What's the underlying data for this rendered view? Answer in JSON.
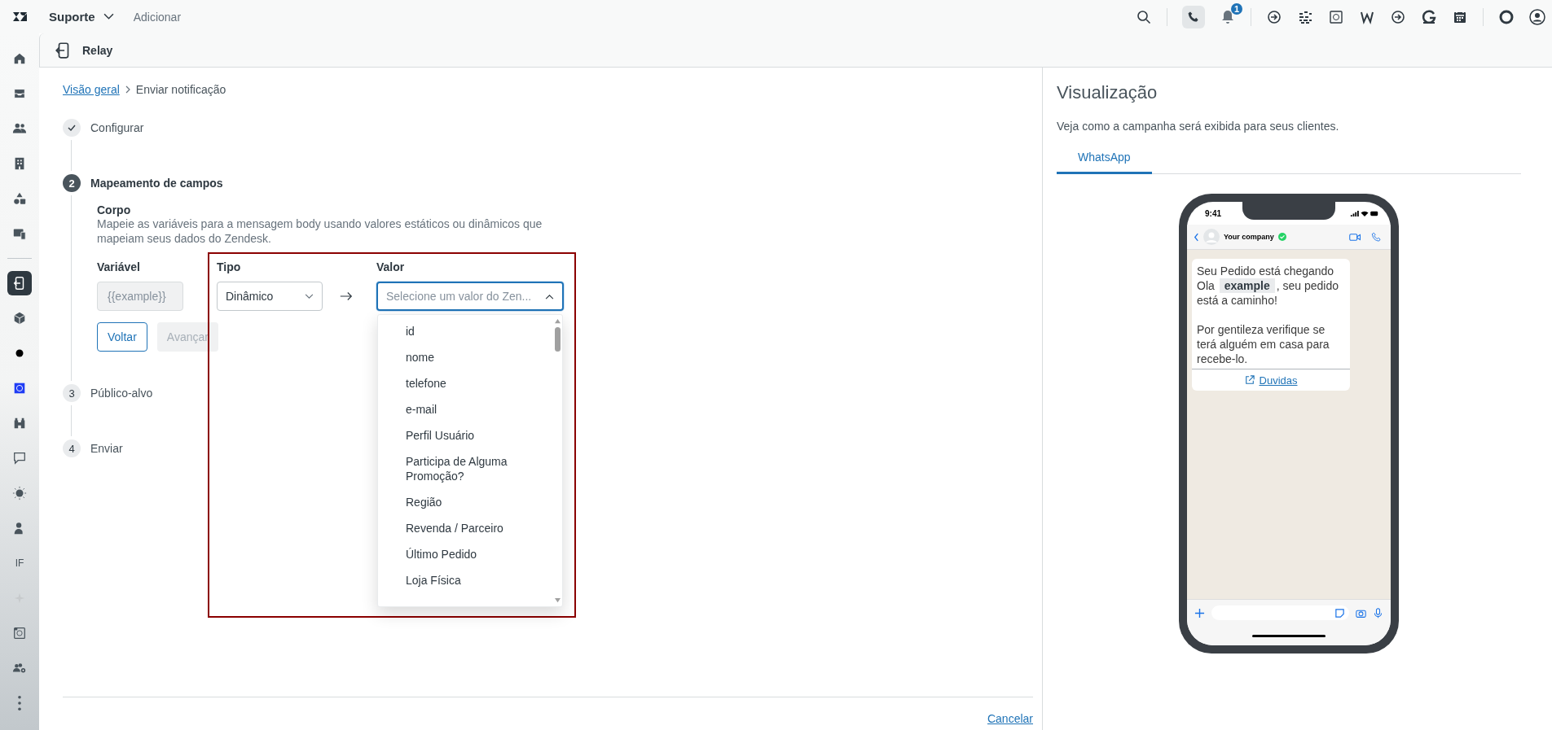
{
  "topbar": {
    "product": "Suporte",
    "add": "Adicionar",
    "notification_count": "1"
  },
  "sidebar": {
    "items": [
      {
        "selected": false
      },
      {
        "selected": false
      },
      {
        "selected": false
      },
      {
        "selected": false
      },
      {
        "selected": false
      },
      {
        "selected": false
      },
      {
        "selected": true
      },
      {
        "selected": false
      },
      {
        "selected": false
      },
      {
        "selected": false
      },
      {
        "selected": false
      },
      {
        "selected": false
      },
      {
        "selected": false
      },
      {
        "selected": false
      },
      {
        "selected": false,
        "label": "IF"
      },
      {
        "selected": false
      },
      {
        "selected": false
      },
      {
        "selected": false
      },
      {
        "selected": false
      }
    ]
  },
  "header": {
    "title": "Relay"
  },
  "breadcrumb": {
    "link": "Visão geral",
    "current": "Enviar notificação"
  },
  "steps": [
    {
      "kind": "done",
      "label": "Configurar"
    },
    {
      "kind": "current",
      "number": "2",
      "label": "Mapeamento de campos"
    },
    {
      "kind": "pending",
      "number": "3",
      "label": "Público-alvo"
    },
    {
      "kind": "pending",
      "number": "4",
      "label": "Enviar"
    }
  ],
  "mapping": {
    "section_title": "Corpo",
    "description": "Mapeie as variáveis para a mensagem body usando valores estáticos ou dinâmicos que mapeiam seus dados do Zendesk.",
    "columns": [
      "Variável",
      "Tipo",
      "Valor"
    ],
    "variable": "{{example}}",
    "type": "Dinâmico",
    "value_placeholder": "Selecione um valor do Zen...",
    "expanded": true,
    "options": [
      "id",
      "nome",
      "telefone",
      "e-mail",
      "Perfil Usuário",
      "Participa de Alguma Promoção?",
      "Região",
      "Revenda / Parceiro",
      "Último Pedido",
      "Loja Física"
    ],
    "back_button": "Voltar",
    "next_button": {
      "label": "Avançar",
      "disabled": true
    }
  },
  "footer": {
    "cancel": "Cancelar"
  },
  "preview": {
    "title": "Visualização",
    "description": "Veja como a campanha será exibida para seus clientes.",
    "tabs": [
      {
        "label": "WhatsApp",
        "selected": true
      }
    ],
    "phone": {
      "time": "9:41",
      "contact": "Your company",
      "verified": true,
      "message_title": "Seu Pedido está chegando",
      "greeting_before": "Ola",
      "variable": "example",
      "greeting_after": ", seu pedido está a caminho!",
      "body": "Por gentileza verifique se terá alguém em casa para recebe-lo.",
      "link": "Duvidas"
    }
  }
}
